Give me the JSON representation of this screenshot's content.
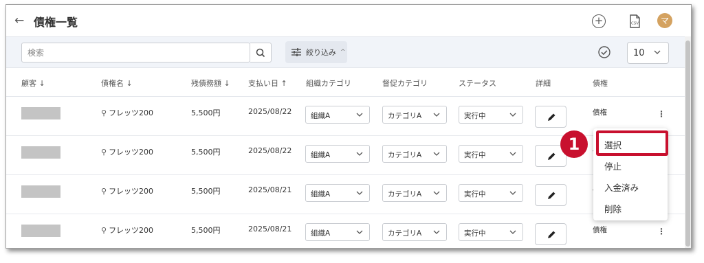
{
  "header": {
    "title": "債権一覧",
    "back_icon": "arrow-left-icon",
    "add_icon": "plus-circle-icon",
    "csv_label": "CSV",
    "avatar_initial": "マ",
    "avatar_color": "#d4a260"
  },
  "toolbar": {
    "search_placeholder": "検索",
    "filter_label": "絞り込み",
    "per_page": "10"
  },
  "table": {
    "headers": [
      "顧客 ↓",
      "債権名 ↓",
      "残債務額 ↓",
      "支払い日 ↑",
      "組織カテゴリ",
      "督促カテゴリ",
      "ステータス",
      "詳細",
      "債権"
    ],
    "rows": [
      {
        "debt_name": "フレッツ200",
        "amount": "5,500円",
        "date": "2025/08/22",
        "org": "組織A",
        "dun": "カテゴリA",
        "status": "実行中",
        "saiken": "債権"
      },
      {
        "debt_name": "フレッツ200",
        "amount": "5,500円",
        "date": "2025/08/22",
        "org": "組織A",
        "dun": "カテゴリA",
        "status": "実行中",
        "saiken": "債権"
      },
      {
        "debt_name": "フレッツ200",
        "amount": "5,500円",
        "date": "2025/08/21",
        "org": "組織A",
        "dun": "カテゴリA",
        "status": "実行中",
        "saiken": "債権"
      },
      {
        "debt_name": "フレッツ200",
        "amount": "5,500円",
        "date": "2025/08/21",
        "org": "組織A",
        "dun": "カテゴリA",
        "status": "実行中",
        "saiken": "債権"
      }
    ]
  },
  "menu": {
    "items": [
      "選択",
      "停止",
      "入金済み",
      "削除"
    ]
  },
  "annotation": {
    "step_number": "1",
    "color": "#c8102e"
  }
}
